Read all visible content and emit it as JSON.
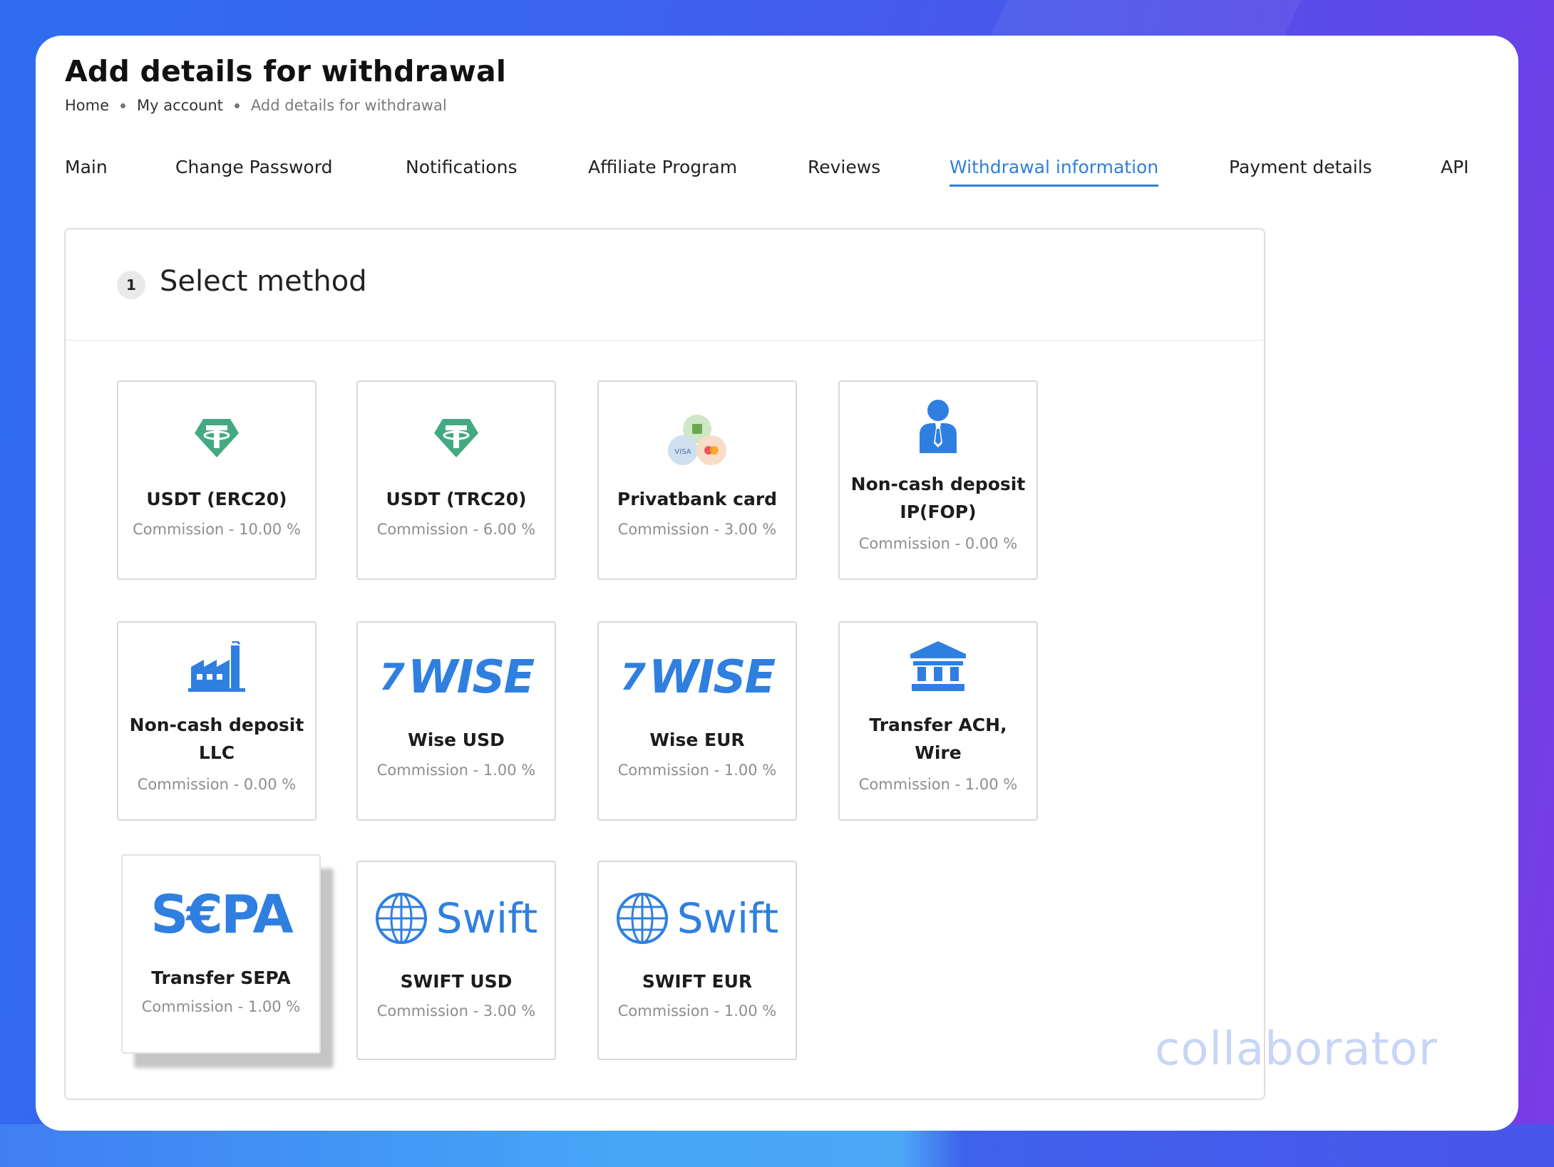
{
  "page": {
    "title": "Add details for withdrawal"
  },
  "breadcrumb": [
    "Home",
    "My account",
    "Add details for withdrawal"
  ],
  "tabs": [
    {
      "label": "Main"
    },
    {
      "label": "Change Password"
    },
    {
      "label": "Notifications"
    },
    {
      "label": "Affiliate Program"
    },
    {
      "label": "Reviews"
    },
    {
      "label": "Withdrawal information",
      "active": true
    },
    {
      "label": "Payment details"
    },
    {
      "label": "API"
    }
  ],
  "step": {
    "number": "1",
    "title": "Select method"
  },
  "methods": [
    {
      "label": "USDT (ERC20)",
      "commission": "Commission - 10.00 %",
      "icon": "tether-icon"
    },
    {
      "label": "USDT (TRC20)",
      "commission": "Commission - 6.00 %",
      "icon": "tether-icon"
    },
    {
      "label": "Privatbank card",
      "commission": "Commission - 3.00 %",
      "icon": "card-icon",
      "icon_text": "VISA"
    },
    {
      "label_line1": "Non-cash deposit",
      "label_line2": "IP(FOP)",
      "commission": "Commission - 0.00 %",
      "icon": "person-icon"
    },
    {
      "label_line1": "Non-cash deposit",
      "label_line2": "LLC",
      "commission": "Commission - 0.00 %",
      "icon": "factory-icon"
    },
    {
      "label": "Wise USD",
      "commission": "Commission - 1.00 %",
      "icon": "wise-logo",
      "logo_text": "WISE",
      "logo_mark": "7"
    },
    {
      "label": "Wise EUR",
      "commission": "Commission - 1.00 %",
      "icon": "wise-logo",
      "logo_text": "WISE",
      "logo_mark": "7"
    },
    {
      "label_line1": "Transfer ACH,",
      "label_line2": "Wire",
      "commission": "Commission - 1.00 %",
      "icon": "bank-icon"
    },
    {
      "label": "Transfer SEPA",
      "commission": "Commission - 1.00 %",
      "icon": "sepa-logo",
      "logo_text": "S€PA",
      "selected": true
    },
    {
      "label": "SWIFT USD",
      "commission": "Commission - 3.00 %",
      "icon": "swift-logo",
      "logo_text": "Swift"
    },
    {
      "label": "SWIFT EUR",
      "commission": "Commission - 1.00 %",
      "icon": "swift-logo",
      "logo_text": "Swift"
    }
  ],
  "watermark": "collaborator",
  "colors": {
    "accent": "#2f7fd8",
    "logo_blue": "#2f7fe0",
    "tether_green": "#43a980"
  }
}
